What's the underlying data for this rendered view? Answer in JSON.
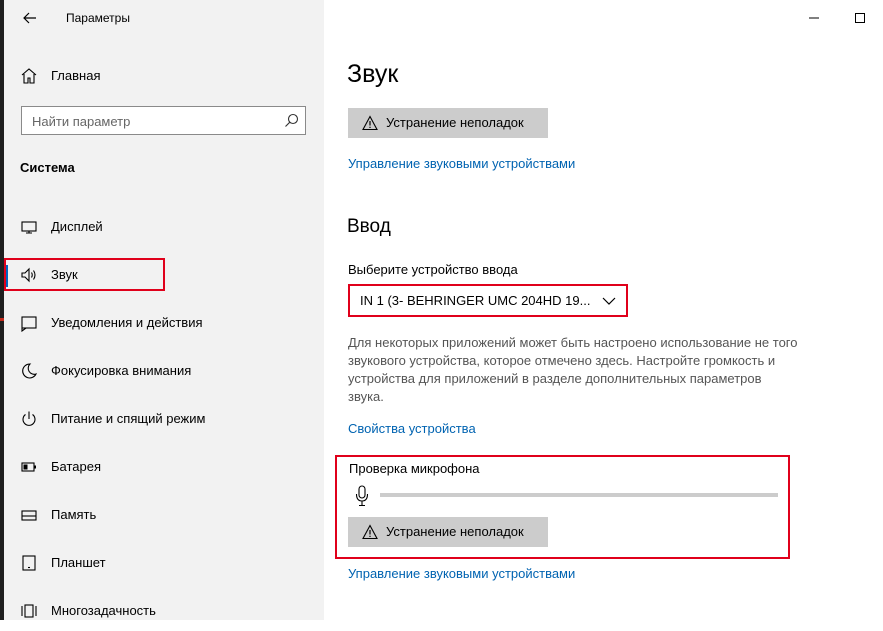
{
  "window": {
    "title": "Параметры",
    "controls": [
      "minimize",
      "maximize"
    ]
  },
  "sidebar": {
    "home_label": "Главная",
    "search_placeholder": "Найти параметр",
    "section": "Система",
    "items": [
      {
        "label": "Дисплей",
        "icon": "monitor-icon"
      },
      {
        "label": "Звук",
        "icon": "speaker-icon",
        "active": true
      },
      {
        "label": "Уведомления и действия",
        "icon": "notification-icon"
      },
      {
        "label": "Фокусировка внимания",
        "icon": "moon-icon"
      },
      {
        "label": "Питание и спящий режим",
        "icon": "power-icon"
      },
      {
        "label": "Батарея",
        "icon": "battery-icon"
      },
      {
        "label": "Память",
        "icon": "storage-icon"
      },
      {
        "label": "Планшет",
        "icon": "tablet-icon"
      },
      {
        "label": "Многозадачность",
        "icon": "multitask-icon"
      }
    ]
  },
  "main": {
    "title": "Звук",
    "troubleshoot_label": "Устранение неполадок",
    "manage_devices_link": "Управление звуковыми устройствами",
    "input_section": {
      "title": "Ввод",
      "select_label": "Выберите устройство ввода",
      "selected_device": "IN 1 (3- BEHRINGER UMC 204HD 19...",
      "description": "Для некоторых приложений может быть настроено использование не того звукового устройства, которое отмечено здесь. Настройте громкость и устройства для приложений в разделе дополнительных параметров звука.",
      "device_properties_link": "Свойства устройства"
    },
    "mic_test": {
      "label": "Проверка микрофона",
      "level": 0,
      "troubleshoot_label": "Устранение неполадок",
      "manage_devices_link": "Управление звуковыми устройствами"
    }
  },
  "colors": {
    "accent": "#0067c0",
    "link": "#0063b1",
    "highlight": "#e0001b",
    "sidebar_bg": "#f2f2f2",
    "button_bg": "#cccccc"
  }
}
